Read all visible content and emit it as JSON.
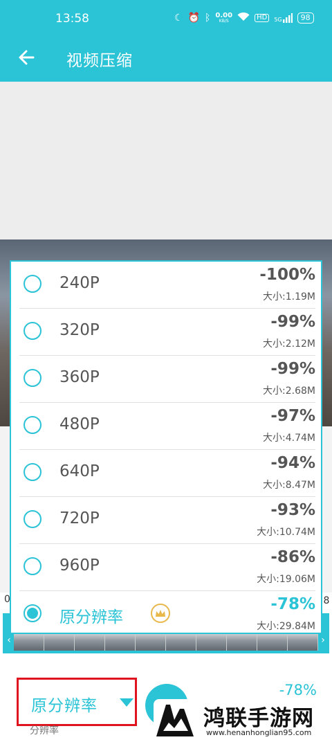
{
  "status_bar": {
    "time": "13:58",
    "net_speed_value": "0.00",
    "net_speed_unit": "KB/S",
    "signal_label": "5G",
    "battery": "98"
  },
  "app_bar": {
    "title": "视频压缩",
    "back_icon": "arrow-left-icon"
  },
  "resolution_options": [
    {
      "label": "240P",
      "percent": "-100%",
      "size": "大小:1.19M",
      "selected": false
    },
    {
      "label": "320P",
      "percent": "-99%",
      "size": "大小:2.12M",
      "selected": false
    },
    {
      "label": "360P",
      "percent": "-99%",
      "size": "大小:2.68M",
      "selected": false
    },
    {
      "label": "480P",
      "percent": "-97%",
      "size": "大小:4.74M",
      "selected": false
    },
    {
      "label": "640P",
      "percent": "-94%",
      "size": "大小:8.47M",
      "selected": false
    },
    {
      "label": "720P",
      "percent": "-93%",
      "size": "大小:10.74M",
      "selected": false
    },
    {
      "label": "960P",
      "percent": "-86%",
      "size": "大小:19.06M",
      "selected": false
    },
    {
      "label": "原分辨率",
      "percent": "-78%",
      "size": "大小:29.84M",
      "selected": true,
      "badge_icon": "crown-icon"
    }
  ],
  "timeline": {
    "left_marker": "0",
    "right_marker": "8"
  },
  "bottom": {
    "resolution_select_label": "原分辨率",
    "resolution_caption": "分辨率",
    "percent": "-78%"
  },
  "watermark": {
    "title": "鸿联手游网",
    "url": "www.henanhonglian95.com"
  },
  "colors": {
    "accent": "#2bc3d6",
    "highlight_border": "#e0141e",
    "crown": "#e8b84a"
  }
}
